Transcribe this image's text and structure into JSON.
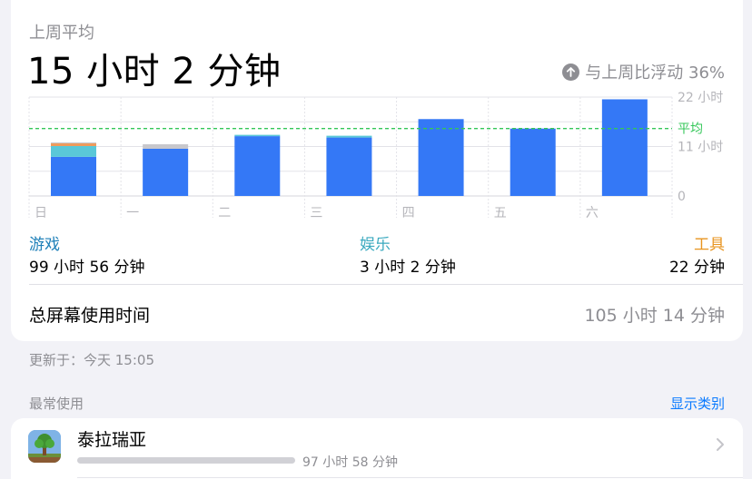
{
  "header": {
    "subtitle": "上周平均",
    "average": "15 小时 2 分钟",
    "delta_text": "与上周比浮动 36%",
    "delta_icon": "arrow-up-circle-icon"
  },
  "chart_data": {
    "type": "bar",
    "categories": [
      "日",
      "一",
      "二",
      "三",
      "四",
      "五",
      "六"
    ],
    "series": [
      {
        "name": "游戏",
        "color": "#3478f6",
        "values": [
          8.7,
          10.5,
          13.3,
          13.0,
          17.1,
          15.0,
          21.5
        ]
      },
      {
        "name": "娱乐",
        "color": "#5ac8d8",
        "values": [
          2.4,
          0,
          0.3,
          0.4,
          0,
          0,
          0
        ]
      },
      {
        "name": "工具",
        "color": "#f09a5a",
        "values": [
          0.6,
          0,
          0,
          0,
          0,
          0,
          0
        ]
      },
      {
        "name": "",
        "color": "#c7c7cc",
        "values": [
          0.2,
          1.0,
          0,
          0,
          0,
          0,
          0
        ]
      }
    ],
    "ytick_labels": [
      "22 小时",
      "11 小时",
      "0"
    ],
    "ylim": [
      0,
      22
    ],
    "ytick_values": [
      22,
      11,
      0
    ],
    "average_value": 15.0,
    "average_label": "平均",
    "average_color": "#34c759",
    "grid": true
  },
  "categories": [
    {
      "name": "游戏",
      "value": "99 小时 56 分钟",
      "color": "#1d7fb8"
    },
    {
      "name": "娱乐",
      "value": "3 小时 2 分钟",
      "color": "#3aa9bf"
    },
    {
      "name": "工具",
      "value": "22 分钟",
      "color": "#e8941f"
    }
  ],
  "total": {
    "label": "总屏幕使用时间",
    "value": "105 小时 14 分钟"
  },
  "updated": "更新于：今天 15:05",
  "most_used": {
    "title": "最常使用",
    "show_categories": "显示类别",
    "apps": [
      {
        "name": "泰拉瑞亚",
        "time": "97 小时 58 分钟",
        "icon": "terraria-app-icon",
        "usage_fraction": 1.0
      }
    ]
  }
}
